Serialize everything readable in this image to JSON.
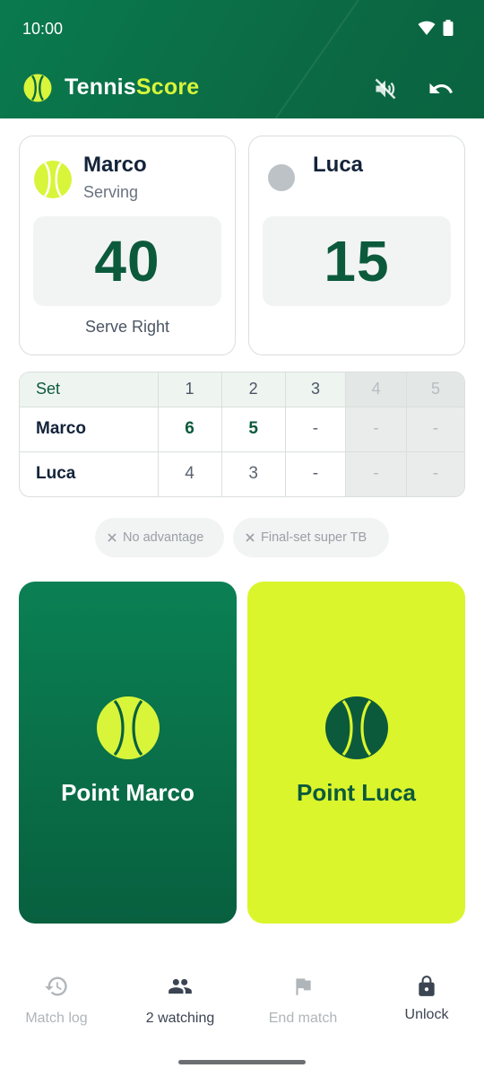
{
  "status_bar": {
    "time": "10:00"
  },
  "app_bar": {
    "brand_part1": "Tennis",
    "brand_part2": "Score"
  },
  "players": [
    {
      "name": "Marco",
      "status": "Serving",
      "score": "40",
      "footer": "Serve Right"
    },
    {
      "name": "Luca",
      "status": "",
      "score": "15",
      "footer": ""
    }
  ],
  "sets_table": {
    "header": [
      "Set",
      "1",
      "2",
      "3",
      "4",
      "5"
    ],
    "rows": [
      {
        "name": "Marco",
        "sets": [
          "6",
          "5",
          "-",
          "-",
          "-"
        ]
      },
      {
        "name": "Luca",
        "sets": [
          "4",
          "3",
          "-",
          "-",
          "-"
        ]
      }
    ]
  },
  "rules": [
    {
      "label": "No advantage"
    },
    {
      "label": "Final-set super TB"
    }
  ],
  "point_buttons": [
    {
      "label": "Point Marco"
    },
    {
      "label": "Point Luca"
    }
  ],
  "bottom_nav": [
    {
      "label": "Match log"
    },
    {
      "label": "2 watching"
    },
    {
      "label": "End match"
    },
    {
      "label": "Unlock"
    }
  ],
  "colors": {
    "primary_green": "#0b6a44",
    "accent_yellow": "#daf52c",
    "text_dark": "#13233a"
  }
}
